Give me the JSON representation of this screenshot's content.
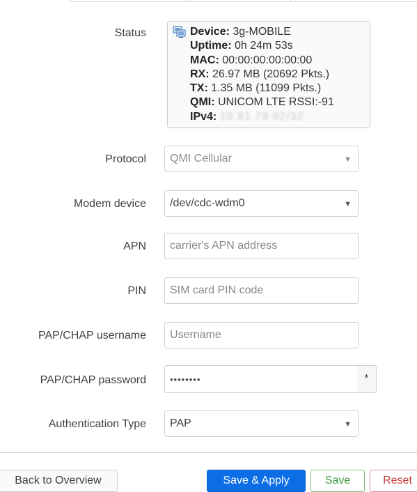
{
  "status": {
    "label": "Status",
    "device_key": "Device:",
    "device_val": "3g-MOBILE",
    "uptime_key": "Uptime:",
    "uptime_val": "0h 24m 53s",
    "mac_key": "MAC:",
    "mac_val": "00:00:00:00:00:00",
    "rx_key": "RX:",
    "rx_val": "26.97 MB (20692 Pkts.)",
    "tx_key": "TX:",
    "tx_val": "1.35 MB (11099 Pkts.)",
    "qmi_key": "QMI:",
    "qmi_val": "UNICOM LTE RSSI:-91",
    "ipv4_key": "IPv4:",
    "ipv4_val": "10.81.79.92/32",
    "icon": "network-device-icon"
  },
  "fields": {
    "protocol": {
      "label": "Protocol",
      "value": "QMI Cellular"
    },
    "modem": {
      "label": "Modem device",
      "value": "/dev/cdc-wdm0"
    },
    "apn": {
      "label": "APN",
      "placeholder": "carrier's APN address"
    },
    "pin": {
      "label": "PIN",
      "placeholder": "SIM card PIN code"
    },
    "username": {
      "label": "PAP/CHAP username",
      "placeholder": "Username"
    },
    "password": {
      "label": "PAP/CHAP password",
      "value": "••••••••",
      "reveal": "*"
    },
    "auth": {
      "label": "Authentication Type",
      "value": "PAP"
    }
  },
  "caret": "▼",
  "actions": {
    "back": "Back to Overview",
    "apply": "Save & Apply",
    "save": "Save",
    "reset": "Reset"
  },
  "colors": {
    "apply": "#0b6ee6",
    "save": "#3c9a3a",
    "reset": "#cc3b3b"
  }
}
